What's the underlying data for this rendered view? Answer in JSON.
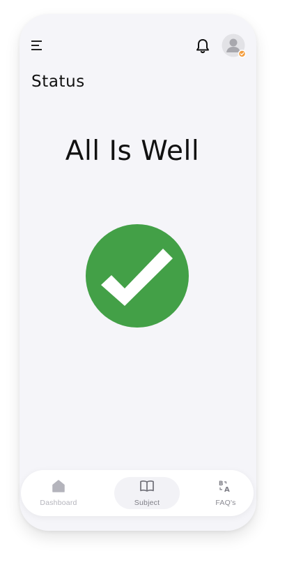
{
  "header": {
    "menu_icon": "hamburger-menu-icon",
    "notification_icon": "bell-icon",
    "avatar_icon": "user-avatar",
    "avatar_badge_color": "#f39c3d"
  },
  "page": {
    "title": "Status",
    "headline": "All Is Well",
    "status_icon": "checkmark-circle-icon",
    "status_color": "#43a047"
  },
  "bottom_nav": {
    "items": [
      {
        "label": "Dashboard",
        "icon": "home-icon",
        "active": false
      },
      {
        "label": "Subject",
        "icon": "book-icon",
        "active": true
      },
      {
        "label": "FAQ's",
        "icon": "translate-icon",
        "active": false
      }
    ]
  }
}
